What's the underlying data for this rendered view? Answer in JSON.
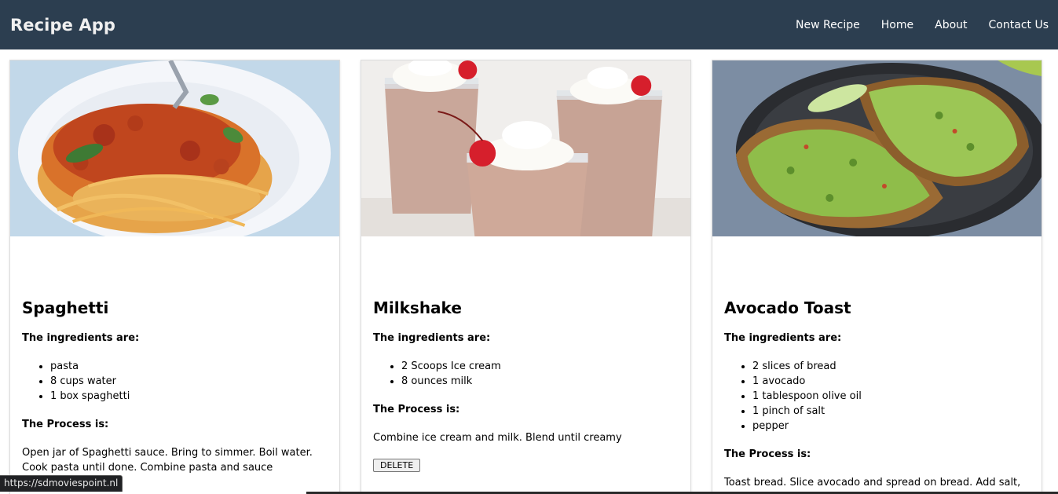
{
  "navbar": {
    "brand": "Recipe App",
    "links": [
      "New Recipe",
      "Home",
      "About",
      "Contact Us"
    ],
    "background": "#2c3e50"
  },
  "recipes": [
    {
      "title": "Spaghetti",
      "image_icon": "spaghetti-photo",
      "ingredients_label": "The ingredients are:",
      "ingredients": [
        "pasta",
        "8 cups water",
        "1 box spaghetti"
      ],
      "process_label": "The Process is:",
      "process": "Open jar of Spaghetti sauce. Bring to simmer. Boil water. Cook pasta until done. Combine pasta and sauce"
    },
    {
      "title": "Milkshake",
      "image_icon": "milkshake-photo",
      "ingredients_label": "The ingredients are:",
      "ingredients": [
        "2 Scoops Ice cream",
        "8 ounces milk"
      ],
      "process_label": "The Process is:",
      "process": "Combine ice cream and milk. Blend until creamy",
      "delete_label": "DELETE"
    },
    {
      "title": "Avocado Toast",
      "image_icon": "avocado-toast-photo",
      "ingredients_label": "The ingredients are:",
      "ingredients": [
        "2 slices of bread",
        "1 avocado",
        "1 tablespoon olive oil",
        "1 pinch of salt",
        "pepper"
      ],
      "process_label": "The Process is:",
      "process": "Toast bread. Slice avocado and spread on bread. Add salt, oil, and pepper to taste."
    }
  ],
  "status_bar": {
    "url": "https://sdmoviespoint.nl"
  }
}
